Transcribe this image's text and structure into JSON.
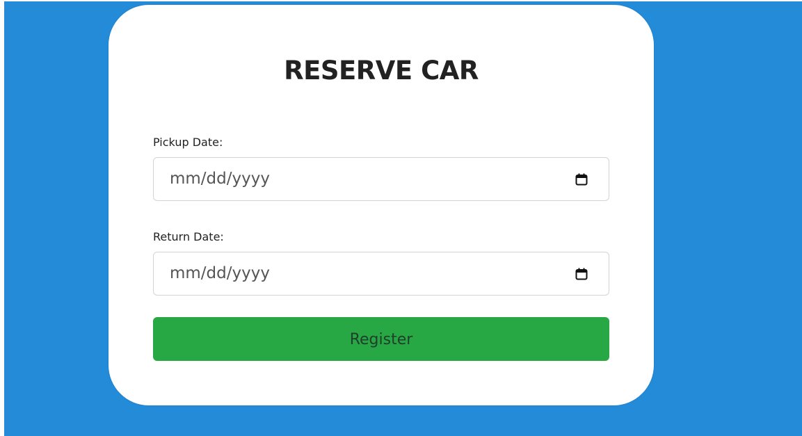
{
  "form": {
    "title": "RESERVE CAR",
    "pickup": {
      "label": "Pickup Date:",
      "placeholder": "mm/dd/yyyy"
    },
    "return": {
      "label": "Return Date:",
      "placeholder": "mm/dd/yyyy"
    },
    "submit_label": "Register"
  },
  "icons": {
    "pickup_picker": "calendar-icon",
    "return_picker": "calendar-icon"
  },
  "colors": {
    "page_background": "#248bd9",
    "card_background": "#ffffff",
    "submit_background": "#28a745"
  }
}
